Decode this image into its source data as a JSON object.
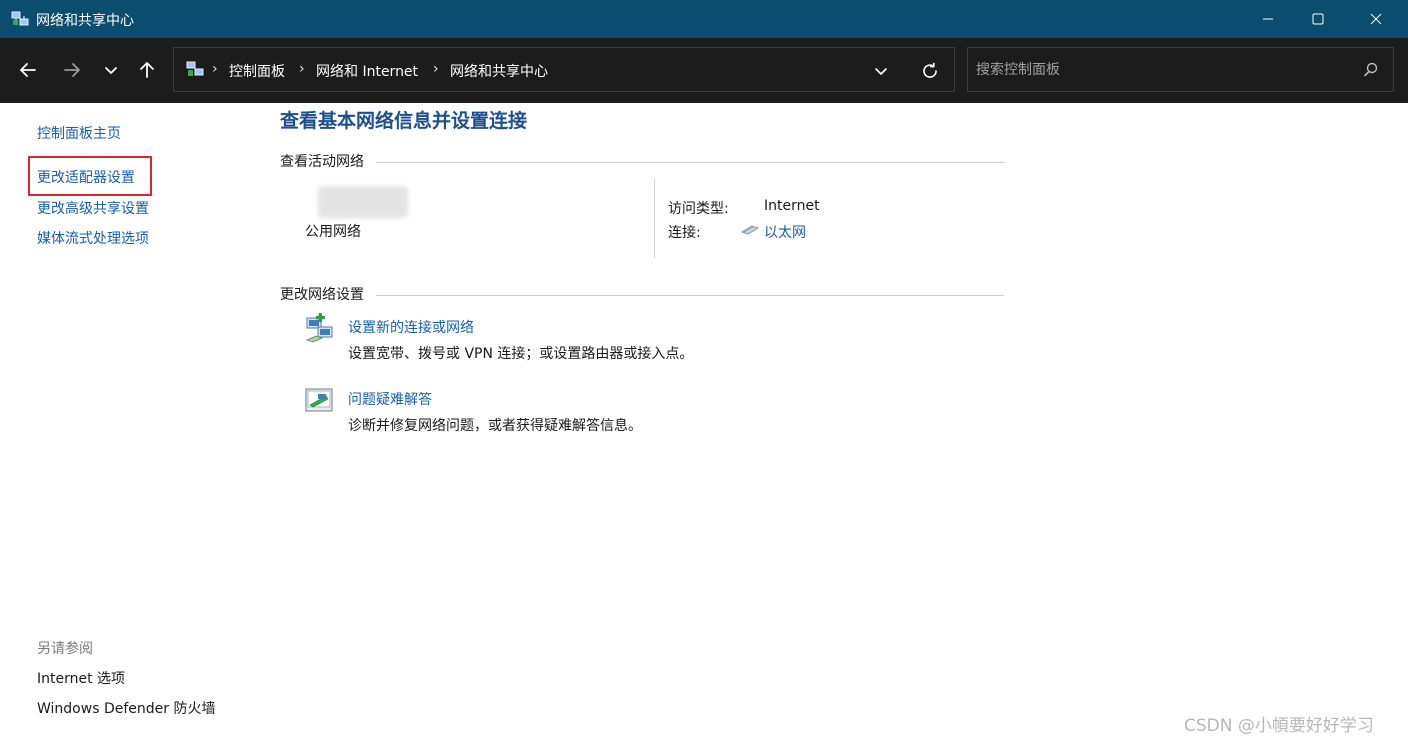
{
  "window": {
    "title": "网络和共享中心",
    "accent_color": "#0a4d6e"
  },
  "titlebar_icons": {
    "app": "network-center-icon",
    "minimize": "minimize-icon",
    "maximize": "maximize-icon",
    "close": "close-icon"
  },
  "nav": {
    "back": "back-arrow-icon",
    "forward": "forward-arrow-icon",
    "recent": "chevron-down-icon",
    "up": "up-arrow-icon",
    "breadcrumb": [
      "控制面板",
      "网络和 Internet",
      "网络和共享中心"
    ],
    "separator": "›",
    "search_placeholder": "搜索控制面板"
  },
  "sidebar": {
    "home": "控制面板主页",
    "links": [
      "更改适配器设置",
      "更改高级共享设置",
      "媒体流式处理选项"
    ],
    "see_also_label": "另请参阅",
    "see_also": [
      "Internet 选项",
      "Windows Defender 防火墙"
    ],
    "highlight_color": "#d9262c"
  },
  "main": {
    "title": "查看基本网络信息并设置连接",
    "active_networks_heading": "查看活动网络",
    "network": {
      "type_text": "公用网络",
      "access_type_label": "访问类型:",
      "access_type_value": "Internet",
      "connection_label": "连接:",
      "connection_value": "以太网"
    },
    "change_settings_heading": "更改网络设置",
    "tasks": [
      {
        "icon": "new-connection-icon",
        "link": "设置新的连接或网络",
        "desc": "设置宽带、拨号或 VPN 连接；或设置路由器或接入点。"
      },
      {
        "icon": "troubleshoot-icon",
        "link": "问题疑难解答",
        "desc": "诊断并修复网络问题，或者获得疑难解答信息。"
      }
    ]
  },
  "watermark": "CSDN @小幁要好好学习"
}
